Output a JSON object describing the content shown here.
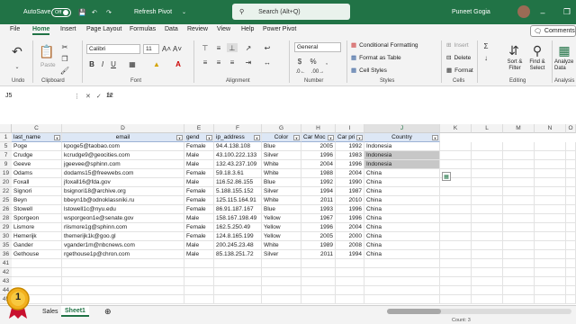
{
  "titlebar": {
    "autosave_label": "AutoSave",
    "autosave_state": "Off",
    "refresh_pivot": "Refresh Pivot",
    "search_placeholder": "Search (Alt+Q)",
    "user_name": "Puneet Gogia"
  },
  "ribbon_tabs": [
    "File",
    "Home",
    "Insert",
    "Page Layout",
    "Formulas",
    "Data",
    "Review",
    "View",
    "Help",
    "Power Pivot"
  ],
  "active_tab": "Home",
  "comments_label": "Comments",
  "ribbon": {
    "undo_label": "Undo",
    "clipboard_label": "Clipboard",
    "paste_label": "Paste",
    "font_label": "Font",
    "font_name": "Calibri",
    "font_size": "11",
    "alignment_label": "Alignment",
    "number_label": "Number",
    "number_format": "General",
    "styles_label": "Styles",
    "conditional_formatting": "Conditional Formatting",
    "format_as_table": "Format as Table",
    "cell_styles": "Cell Styles",
    "cells_label": "Cells",
    "insert": "Insert",
    "delete": "Delete",
    "format": "Format",
    "editing_label": "Editing",
    "sort_filter": "Sort & Filter",
    "find_select": "Find & Select",
    "analyze_data": "Analyze Data",
    "analysis_label": "Analysis"
  },
  "formula_bar": {
    "name_box": "J5",
    "fx": "fx",
    "value": "12"
  },
  "columns": [
    "C",
    "D",
    "E",
    "F",
    "G",
    "H",
    "I",
    "J",
    "K",
    "L",
    "M",
    "N",
    "O"
  ],
  "header_row": {
    "row_num": "1",
    "cells": [
      "last_name",
      "email",
      "gend",
      "ip_address",
      "Color",
      "Car Moc",
      "Car pri",
      "Country"
    ]
  },
  "rows": [
    {
      "num": "5",
      "cells": [
        "Poge",
        "kpoge5@taobao.com",
        "Female",
        "94.4.138.108",
        "Blue",
        "2005",
        "1992",
        "Indonesia"
      ],
      "hl": false
    },
    {
      "num": "7",
      "cells": [
        "Crudge",
        "kcrudge9@geocities.com",
        "Male",
        "43.100.222.133",
        "Silver",
        "1996",
        "1983",
        "Indonesia"
      ],
      "hl": true
    },
    {
      "num": "9",
      "cells": [
        "Geeve",
        "jgeevee@sphinn.com",
        "Male",
        "132.43.237.109",
        "White",
        "2004",
        "1996",
        "Indonesia"
      ],
      "hl": true
    },
    {
      "num": "19",
      "cells": [
        "Odams",
        "dodams15@freewebs.com",
        "Female",
        "59.18.3.61",
        "White",
        "1988",
        "2004",
        "China"
      ],
      "hl": false
    },
    {
      "num": "20",
      "cells": [
        "Foxall",
        "jfoxall16@fda.gov",
        "Male",
        "116.52.86.155",
        "Blue",
        "1992",
        "1990",
        "China"
      ],
      "hl": false
    },
    {
      "num": "22",
      "cells": [
        "Signori",
        "bsignori18@archive.org",
        "Female",
        "5.188.155.152",
        "Silver",
        "1994",
        "1987",
        "China"
      ],
      "hl": false
    },
    {
      "num": "25",
      "cells": [
        "Beyn",
        "bbeyn1b@odnoklassniki.ru",
        "Female",
        "125.115.164.91",
        "White",
        "2011",
        "2010",
        "China"
      ],
      "hl": false
    },
    {
      "num": "26",
      "cells": [
        "Stowell",
        "lstowell1c@nyu.edu",
        "Female",
        "86.91.187.167",
        "Blue",
        "1993",
        "1996",
        "China"
      ],
      "hl": false
    },
    {
      "num": "28",
      "cells": [
        "Sporgeon",
        "wsporgeon1e@senate.gov",
        "Male",
        "158.167.198.49",
        "Yellow",
        "1967",
        "1996",
        "China"
      ],
      "hl": false
    },
    {
      "num": "29",
      "cells": [
        "Lismore",
        "rlismore1g@sphinn.com",
        "Female",
        "162.5.250.49",
        "Yellow",
        "1996",
        "2004",
        "China"
      ],
      "hl": false
    },
    {
      "num": "30",
      "cells": [
        "Hemerijk",
        "themerijk1k@goo.gl",
        "Female",
        "124.8.165.199",
        "Yellow",
        "2005",
        "2000",
        "China"
      ],
      "hl": false
    },
    {
      "num": "35",
      "cells": [
        "Gander",
        "vgander1m@nbcnews.com",
        "Male",
        "200.245.23.48",
        "White",
        "1989",
        "2008",
        "China"
      ],
      "hl": false
    },
    {
      "num": "36",
      "cells": [
        "Gethouse",
        "rgethouse1p@chron.com",
        "Male",
        "85.138.251.72",
        "Silver",
        "2011",
        "1994",
        "China"
      ],
      "hl": false
    }
  ],
  "empty_rows": [
    "41",
    "42",
    "43",
    "44",
    "45"
  ],
  "sheet_tabs": [
    "Sales",
    "Sheet1"
  ],
  "active_sheet": "Sheet1",
  "status": {
    "count": "Count: 3"
  },
  "badge_number": "1"
}
